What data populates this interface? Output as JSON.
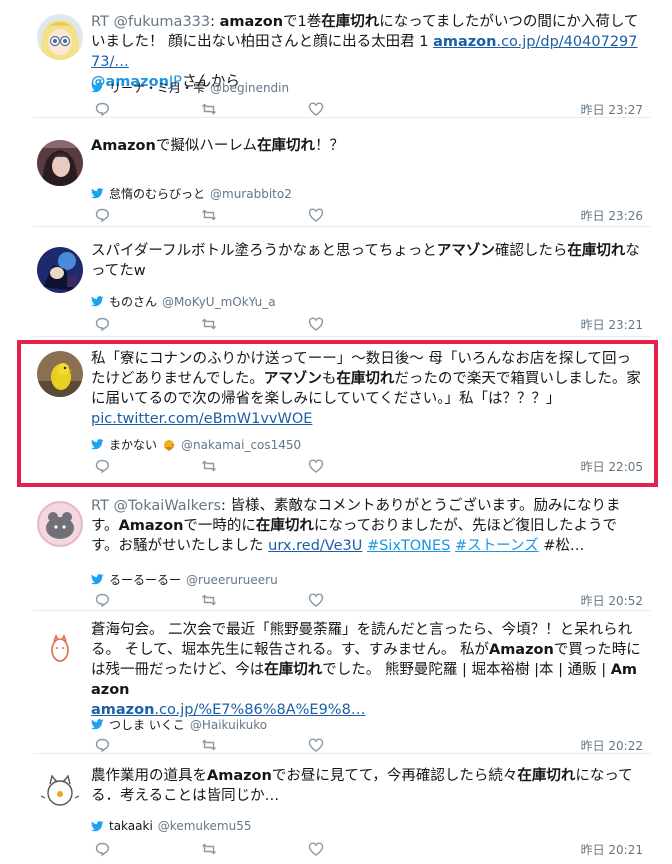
{
  "tweets": [
    {
      "rt_prefix": "RT ",
      "rt_user": "@fukuma333",
      "rt_colon": ": ",
      "seg1_b": "amazon",
      "seg2": "で1巻",
      "seg3_b": "在庫切れ",
      "seg4": "になってましたがいつの間にか入荷していました！ 顔に出ない柏田さんと顔に出る太田君 1 ",
      "link1_b": "amazon",
      "link1": ".co.jp/dp/4040729773/…",
      "mention_b": "@amazon",
      "mention_rest": "JP",
      "seg5": "さんから",
      "user_name": "リーナ・ミ月・雫",
      "user_handle": "@beginendin",
      "time": "昨日 23:27"
    },
    {
      "seg1_b": "Amazon",
      "seg2": "で擬似ハーレム",
      "seg3_b": "在庫切れ",
      "seg4": "！？",
      "user_name": "怠惰のむらびっと",
      "user_handle": "@murabbito2",
      "time": "昨日 23:26"
    },
    {
      "seg1": "スパイダーフルボトル塗ろうかなぁと思ってちょっと",
      "seg2_b": "アマゾン",
      "seg3": "確認したら",
      "seg4_b": "在庫切れ",
      "seg5": "なってたw",
      "user_name": "ものさん",
      "user_handle": "@MoKyU_mOkYu_a",
      "time": "昨日 23:21"
    },
    {
      "seg1": "私「寮にコナンのふりかけ送ってーー」～数日後～ 母「いろんなお店を探して回ったけどありませんでした。",
      "seg2_b": "アマゾン",
      "seg3": "も",
      "seg4_b": "在庫切れ",
      "seg5": "だったので楽天で箱買いしました。家に届いてるので次の帰省を楽しみにしていてください。」私「は？？？」",
      "link": "pic.twitter.com/eBmW1vvWOE",
      "user_name": "まかない",
      "user_handle": "@nakamai_cos1450",
      "time": "昨日 22:05"
    },
    {
      "rt_prefix": "RT ",
      "rt_user": "@TokaiWalkers",
      "rt_colon": ": 皆様、素敵なコメントありがとうございます。励みになります。",
      "seg1_b": "Amazon",
      "seg2": "で一時的に",
      "seg3_b": "在庫切れ",
      "seg4": "になっておりましたが、先ほど復旧したようです。お騒がせいたしました ",
      "link": "urx.red/Ve3U",
      "tag1": "#SixTONES",
      "tag2": "#ストーンズ",
      "seg5": " #松…",
      "user_name": "るーるーるー",
      "user_handle": "@rueerurueeru",
      "time": "昨日 20:52"
    },
    {
      "seg1": "蒼海句会。 二次会で最近「熊野曼荼羅」を読んだと言ったら、今頃？！と呆れられる。 そして、堀本先生に報告される。す、すみません。 私が",
      "seg2_b": "Amazon",
      "seg3": "で買った時には残一冊だったけど、今は",
      "seg4_b": "在庫切れ",
      "seg5": "でした。 熊野曼陀羅 | 堀本裕樹 |本 | 通販 | ",
      "seg6_b": "Amazon",
      "link_b": "amazon",
      "link": ".co.jp/%E7%86%8A%E9%8…",
      "user_name": "つしま いくこ",
      "user_handle": "@Haikuikuko",
      "time": "昨日 20:22"
    },
    {
      "seg1": "農作業用の道具を",
      "seg2_b": "Amazon",
      "seg3": "でお昼に見てて，今再確認したら続々",
      "seg4_b": "在庫切れ",
      "seg5": "になってる．考えることは皆同じか…",
      "user_name": "takaaki",
      "user_handle": "@kemukemu55",
      "time": "昨日 20:21"
    }
  ],
  "colors": {
    "highlight": "#e5204a",
    "link": "#1b5fa8",
    "mention": "#1b95e0",
    "muted": "#657786",
    "bird": "#1da1f2"
  }
}
